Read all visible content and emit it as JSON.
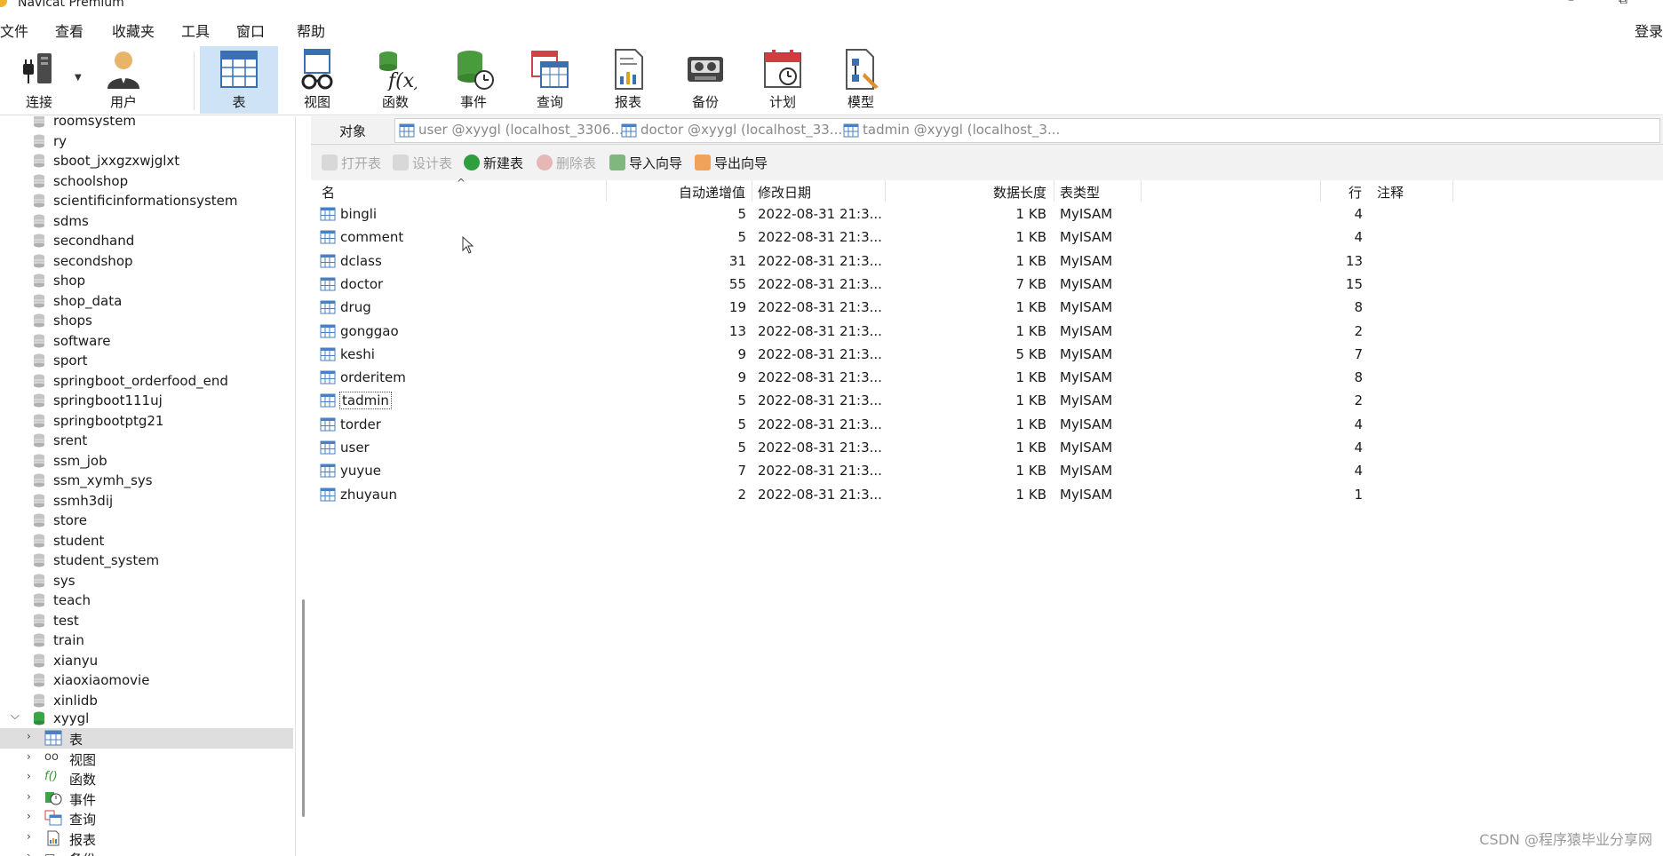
{
  "window": {
    "title": "Navicat Premium",
    "controls": [
      "–",
      "⧉"
    ]
  },
  "menu": {
    "items": [
      "文件",
      "查看",
      "收藏夹",
      "工具",
      "窗口",
      "帮助"
    ],
    "login": "登录"
  },
  "toolbar": {
    "items": [
      {
        "label": "连接",
        "icon": "plug-icon"
      },
      {
        "label": "用户",
        "icon": "user-icon"
      },
      {
        "label": "表",
        "icon": "table-icon",
        "active": true
      },
      {
        "label": "视图",
        "icon": "view-glasses-icon"
      },
      {
        "label": "函数",
        "icon": "function-icon"
      },
      {
        "label": "事件",
        "icon": "event-clock-icon"
      },
      {
        "label": "查询",
        "icon": "query-icon"
      },
      {
        "label": "报表",
        "icon": "report-icon"
      },
      {
        "label": "备份",
        "icon": "backup-icon"
      },
      {
        "label": "计划",
        "icon": "schedule-calendar-icon"
      },
      {
        "label": "模型",
        "icon": "model-icon"
      }
    ]
  },
  "sidebar": {
    "databases": [
      "roomsystem",
      "ry",
      "sboot_jxxgzxwjglxt",
      "schoolshop",
      "scientificinformationsystem",
      "sdms",
      "secondhand",
      "secondshop",
      "shop",
      "shop_data",
      "shops",
      "software",
      "sport",
      "springboot_orderfood_end",
      "springboot111uj",
      "springbootptg21",
      "srent",
      "ssm_job",
      "ssm_xymh_sys",
      "ssmh3dij",
      "store",
      "student",
      "student_system",
      "sys",
      "teach",
      "test",
      "train",
      "xianyu",
      "xiaoxiaomovie",
      "xinlidb"
    ],
    "open_db": "xyygl",
    "children": [
      {
        "label": "表",
        "icon": "table-icon",
        "selected": true
      },
      {
        "label": "视图",
        "icon": "view-glasses-icon"
      },
      {
        "label": "函数",
        "icon": "function-icon"
      },
      {
        "label": "事件",
        "icon": "event-clock-icon"
      },
      {
        "label": "查询",
        "icon": "query-icon"
      },
      {
        "label": "报表",
        "icon": "report-icon"
      },
      {
        "label": "备份",
        "icon": "backup-icon"
      }
    ]
  },
  "object_tabs": {
    "main": "对象",
    "tabs": [
      "user @xyygl (localhost_3306...",
      "doctor @xyygl (localhost_33...",
      "tadmin @xyygl (localhost_3..."
    ]
  },
  "actions": [
    {
      "label": "打开表",
      "enabled": false,
      "color": "#bdbdbd"
    },
    {
      "label": "设计表",
      "enabled": false,
      "color": "#bdbdbd"
    },
    {
      "label": "新建表",
      "enabled": true,
      "color": "#2e9e3e"
    },
    {
      "label": "删除表",
      "enabled": false,
      "color": "#d9a0a0"
    },
    {
      "label": "导入向导",
      "enabled": true,
      "color": "#3a8f4a"
    },
    {
      "label": "导出向导",
      "enabled": true,
      "color": "#e07b22"
    }
  ],
  "table": {
    "headers": {
      "name": "名",
      "auto_increment": "自动递增值",
      "modified": "修改日期",
      "data_length": "数据长度",
      "engine": "表类型",
      "rows": "行",
      "comment": "注释"
    },
    "rows": [
      {
        "name": "bingli",
        "auto": "5",
        "date": "2022-08-31 21:3...",
        "size": "1 KB",
        "engine": "MyISAM",
        "rows": "4"
      },
      {
        "name": "comment",
        "auto": "5",
        "date": "2022-08-31 21:3...",
        "size": "1 KB",
        "engine": "MyISAM",
        "rows": "4"
      },
      {
        "name": "dclass",
        "auto": "31",
        "date": "2022-08-31 21:3...",
        "size": "1 KB",
        "engine": "MyISAM",
        "rows": "13"
      },
      {
        "name": "doctor",
        "auto": "55",
        "date": "2022-08-31 21:3...",
        "size": "7 KB",
        "engine": "MyISAM",
        "rows": "15"
      },
      {
        "name": "drug",
        "auto": "19",
        "date": "2022-08-31 21:3...",
        "size": "1 KB",
        "engine": "MyISAM",
        "rows": "8"
      },
      {
        "name": "gonggao",
        "auto": "13",
        "date": "2022-08-31 21:3...",
        "size": "1 KB",
        "engine": "MyISAM",
        "rows": "2"
      },
      {
        "name": "keshi",
        "auto": "9",
        "date": "2022-08-31 21:3...",
        "size": "5 KB",
        "engine": "MyISAM",
        "rows": "7"
      },
      {
        "name": "orderitem",
        "auto": "9",
        "date": "2022-08-31 21:3...",
        "size": "1 KB",
        "engine": "MyISAM",
        "rows": "8"
      },
      {
        "name": "tadmin",
        "auto": "5",
        "date": "2022-08-31 21:3...",
        "size": "1 KB",
        "engine": "MyISAM",
        "rows": "2",
        "focused": true
      },
      {
        "name": "torder",
        "auto": "5",
        "date": "2022-08-31 21:3...",
        "size": "1 KB",
        "engine": "MyISAM",
        "rows": "4"
      },
      {
        "name": "user",
        "auto": "5",
        "date": "2022-08-31 21:3...",
        "size": "1 KB",
        "engine": "MyISAM",
        "rows": "4"
      },
      {
        "name": "yuyue",
        "auto": "7",
        "date": "2022-08-31 21:3...",
        "size": "1 KB",
        "engine": "MyISAM",
        "rows": "4"
      },
      {
        "name": "zhuyaun",
        "auto": "2",
        "date": "2022-08-31 21:3...",
        "size": "1 KB",
        "engine": "MyISAM",
        "rows": "1"
      }
    ]
  },
  "watermark": "CSDN @程序猿毕业分享网",
  "colors": {
    "accent": "#cfe3f7",
    "db_icon": "#bcbcbc",
    "open_db_icon": "#3aa545",
    "table_icon": "#4a7fc1"
  }
}
